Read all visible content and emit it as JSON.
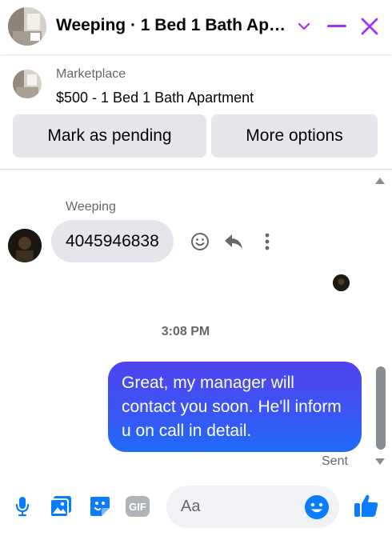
{
  "header": {
    "title": "Weeping · 1 Bed 1 Bath Ap…",
    "icons": {
      "avatar": "listing-photo",
      "chevron": "chevron-down-icon",
      "minimize": "minimize-icon",
      "close": "close-icon"
    },
    "accent_color": "#a033ff"
  },
  "marketplace": {
    "source": "Marketplace",
    "listing": "$500 - 1 Bed 1 Bath Apartment",
    "buttons": {
      "pending": "Mark as pending",
      "more": "More options"
    }
  },
  "chat": {
    "sender_name": "Weeping",
    "incoming_message": "4045946838",
    "message_actions": [
      "smiley-react-icon",
      "reply-icon",
      "more-dots-icon"
    ],
    "timestamp": "3:08 PM",
    "outgoing_message": "Great, my manager will contact you soon. He'll inform u on call in detail.",
    "status": "Sent",
    "colors": {
      "outgoing_bubble": "#3b55f4",
      "incoming_bubble": "#e4e6eb"
    }
  },
  "composer": {
    "placeholder": "Aa",
    "icons": [
      "microphone-icon",
      "image-icon",
      "sticker-icon",
      "gif-icon",
      "emoji-icon",
      "thumbs-up-icon"
    ],
    "gif_label": "GIF",
    "accent_color": "#0a7cff"
  }
}
